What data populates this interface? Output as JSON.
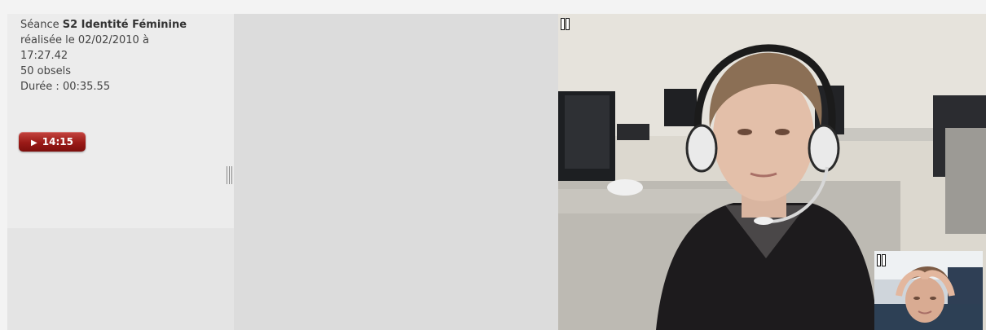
{
  "session": {
    "prefix": "Séance",
    "name": "S2 Identité Féminine",
    "date_line": "réalisée le 02/02/2010 à",
    "time": "17:27.42",
    "obsels": "50 obsels",
    "duration": "Durée : 00:35.55"
  },
  "player": {
    "play_label": "14:15",
    "play_icon": "play-icon",
    "pause_icon": "pause-icon"
  },
  "videos": {
    "main_stream": "webcam-main",
    "pip_stream": "webcam-pip"
  },
  "colors": {
    "play_button": "#9a1a17",
    "info_background": "#ececec",
    "middle_background": "#dcdcdc"
  }
}
